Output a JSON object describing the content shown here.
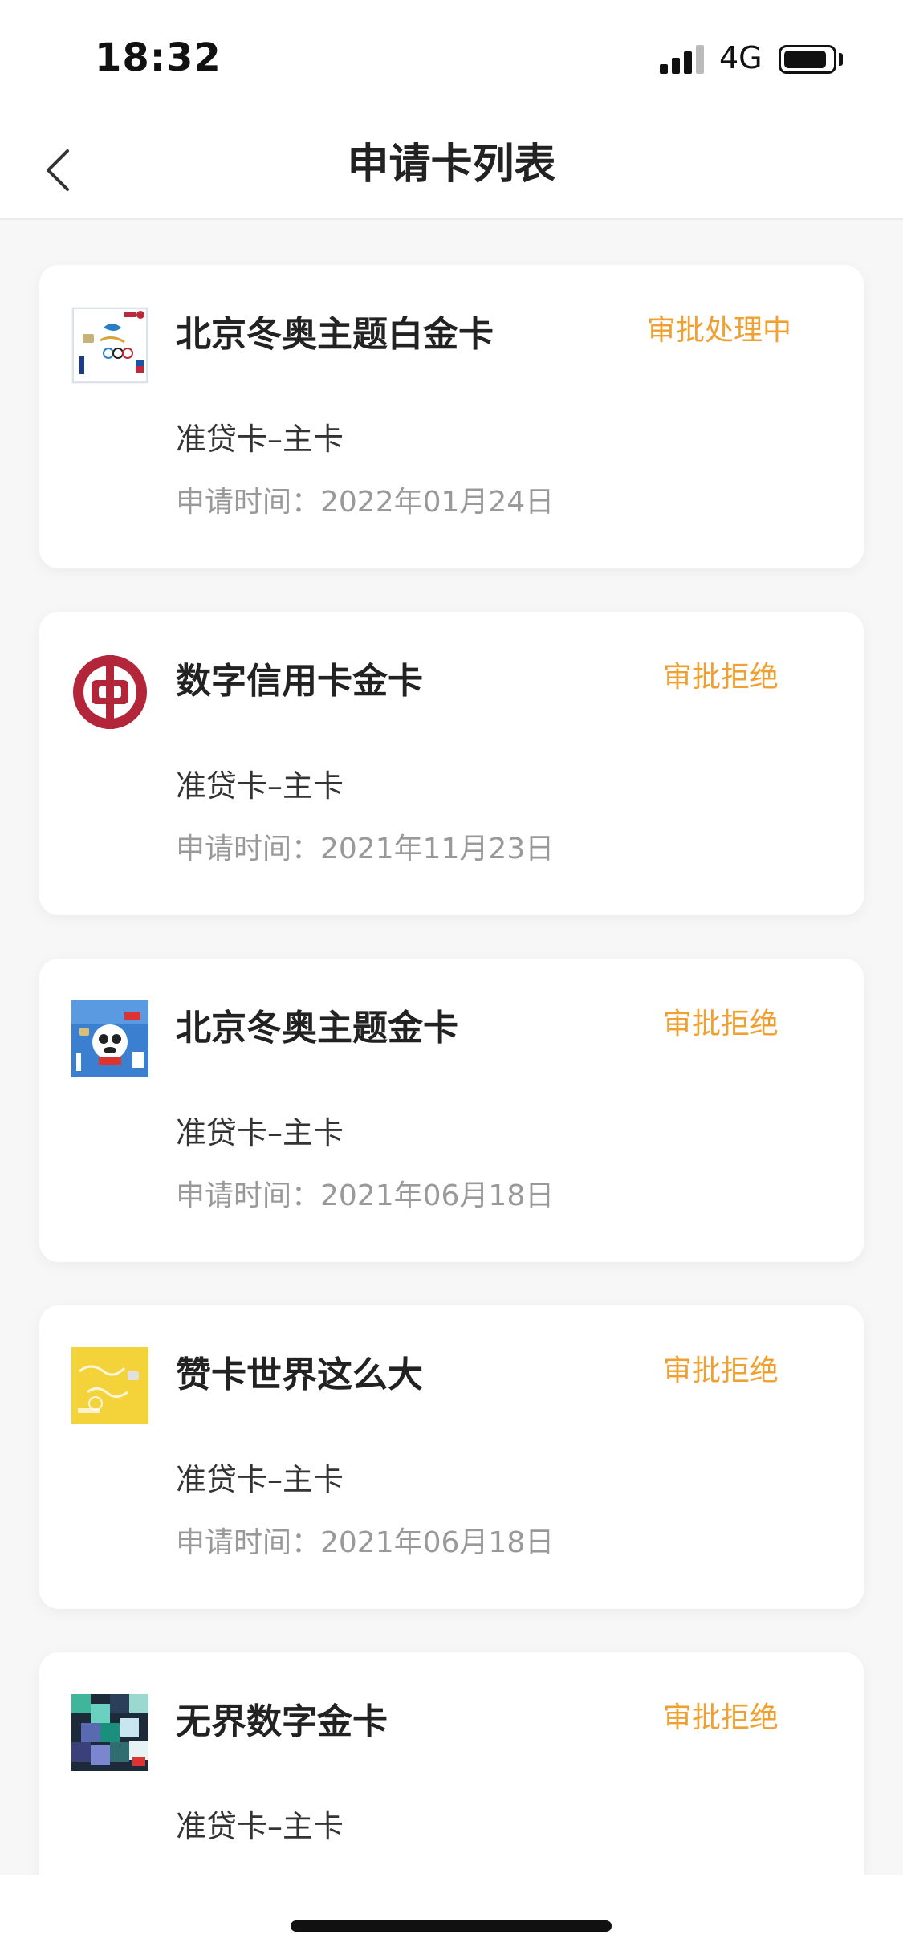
{
  "status_bar": {
    "time": "18:32",
    "network": "4G"
  },
  "nav": {
    "title": "申请卡列表"
  },
  "cards": [
    {
      "name": "北京冬奥主题白金卡",
      "status": "审批处理中",
      "type": "准贷卡–主卡",
      "date": "申请时间：2022年01月24日",
      "thumb": "white-card-image"
    },
    {
      "name": "数字信用卡金卡",
      "status": "审批拒绝",
      "type": "准贷卡–主卡",
      "date": "申请时间：2021年11月23日",
      "thumb": "bank-of-china-logo"
    },
    {
      "name": "北京冬奥主题金卡",
      "status": "审批拒绝",
      "type": "准贷卡–主卡",
      "date": "申请时间：2021年06月18日",
      "thumb": "blue-card-image"
    },
    {
      "name": "赞卡世界这么大",
      "status": "审批拒绝",
      "type": "准贷卡–主卡",
      "date": "申请时间：2021年06月18日",
      "thumb": "yellow-card-image"
    },
    {
      "name": "无界数字金卡",
      "status": "审批拒绝",
      "type": "准贷卡–主卡",
      "date": "",
      "thumb": "pixel-card-image"
    }
  ],
  "colors": {
    "status_accent": "#f0a030",
    "bank_red": "#b3263a"
  }
}
